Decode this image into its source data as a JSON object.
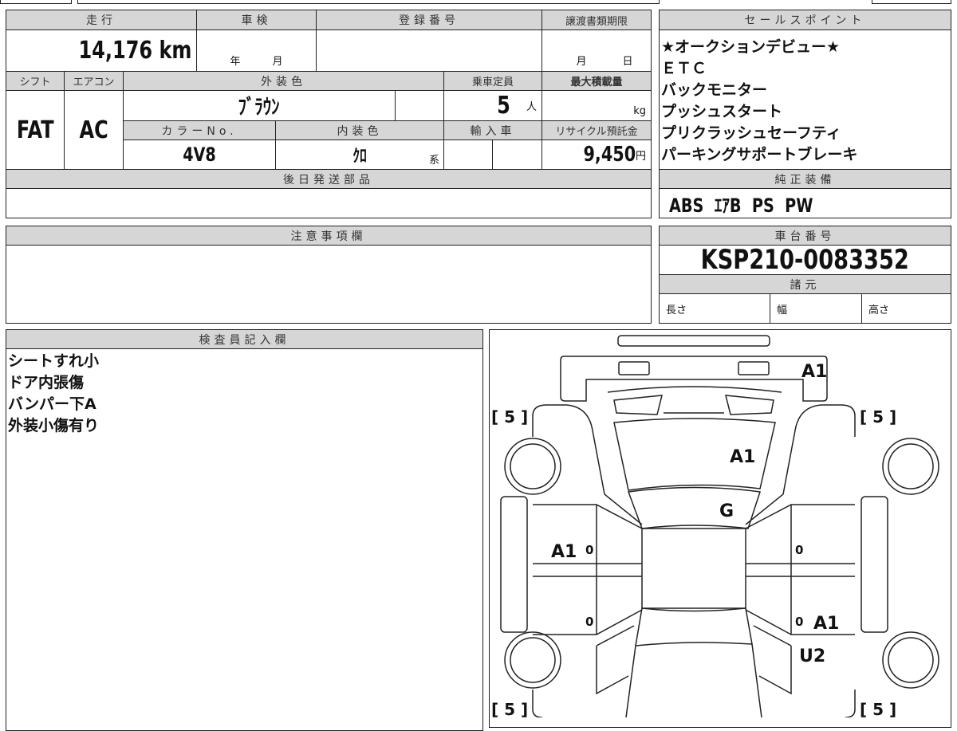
{
  "mileage": {
    "label": "走行",
    "value": "14,176 km"
  },
  "inspection": {
    "label": "車検",
    "year": "年",
    "month": "月"
  },
  "registration": {
    "label": "登録番号",
    "value": ""
  },
  "transfer_deadline": {
    "label": "譲渡書類期限",
    "month": "月",
    "day": "日"
  },
  "shift": {
    "label": "シフト",
    "value": "FAT"
  },
  "aircon": {
    "label": "エアコン",
    "value": "AC"
  },
  "exterior_color": {
    "label": "外装色",
    "value": "ﾌﾞﾗｳﾝ"
  },
  "capacity": {
    "label": "乗車定員",
    "value": "5",
    "unit": "人"
  },
  "max_load": {
    "label": "最大積載量",
    "unit": "kg"
  },
  "color_no": {
    "label": "カラーNo.",
    "value": "4V8"
  },
  "interior_color": {
    "label": "内装色",
    "value": "ｸﾛ",
    "suffix": "系"
  },
  "import": {
    "label": "輸入車"
  },
  "recycle": {
    "label": "リサイクル預託金",
    "value": "9,450",
    "unit": "円"
  },
  "later_parts": {
    "label": "後日発送部品",
    "value": ""
  },
  "sales_points": {
    "label": "セールスポイント",
    "items": [
      "★オークションデビュー★",
      "ＥＴＣ",
      "バックモニター",
      "プッシュスタート",
      "プリクラッシュセーフティ",
      "パーキングサポートブレーキ"
    ]
  },
  "equipment": {
    "label": "純正装備",
    "value": "ABS  ｴｱB  PS  PW"
  },
  "notes": {
    "label": "注意事項欄",
    "value": ""
  },
  "chassis": {
    "label": "車台番号",
    "value": "KSP210-0083352"
  },
  "specs": {
    "label": "諸元",
    "length": "長さ",
    "width": "幅",
    "height": "高さ"
  },
  "inspector": {
    "label": "検査員記入欄",
    "items": [
      "シートすれ小",
      "ドア内張傷",
      "バンパー下A",
      "外装小傷有り"
    ]
  },
  "diagram": {
    "marks": {
      "front_bumper": "A1",
      "hood": "A1",
      "roof_front": "G",
      "left_front_door": "A1",
      "right_rear_door": "A1",
      "right_rear_fender": "U2",
      "lf_door_num": "0",
      "lr_door_num": "0",
      "rf_door_num": "0",
      "rr_door_num": "0"
    },
    "tires": {
      "front_left": "[ 5 ]",
      "front_right": "[ 5 ]",
      "rear_left": "[ 5 ]",
      "rear_right": "[ 5 ]"
    }
  }
}
